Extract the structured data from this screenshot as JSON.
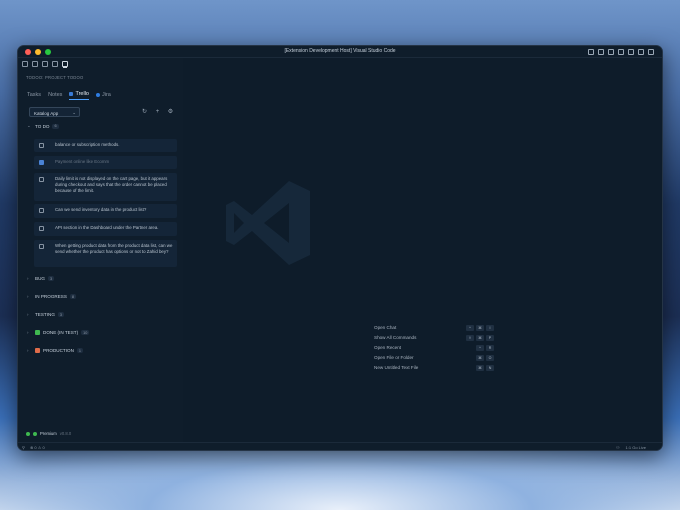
{
  "window": {
    "title": "[Extension Development Host] Visual Studio Code"
  },
  "sidebar": {
    "section_title": "TODOO: PROJECT TODOO",
    "tabs": [
      {
        "label": "Tasks",
        "active": false
      },
      {
        "label": "Notes",
        "active": false
      },
      {
        "label": "Trello",
        "active": true
      },
      {
        "label": "Jira",
        "active": false
      }
    ],
    "board_select": {
      "value": "Katalog App"
    },
    "lists": [
      {
        "name": "TO DO",
        "count": "6",
        "expanded": true,
        "cards": [
          {
            "text": "balance or subscription methods.",
            "checked": false
          },
          {
            "text": "Payment online like Ecomm",
            "checked": true
          },
          {
            "text": "Daily limit is not displayed on the cart page, but it appears during checkout and says that the order cannot be placed because of the limit.",
            "checked": false
          },
          {
            "text": "Can we send inventory data in the product list?",
            "checked": false
          },
          {
            "text": "API section in the Dashboard under the Partner area.",
            "checked": false
          },
          {
            "text": "When getting product data from the product data list, can we send whether the product has options or not to Zahid bey?",
            "checked": false
          }
        ]
      },
      {
        "name": "BUG",
        "count": "3",
        "expanded": false
      },
      {
        "name": "IN PROGRESS",
        "count": "8",
        "expanded": false
      },
      {
        "name": "TESTING",
        "count": "3",
        "expanded": false
      },
      {
        "name": "DONE (IN TEST)",
        "count": "10",
        "expanded": false,
        "emoji": "check-emoji"
      },
      {
        "name": "PRODUCTION",
        "count": "1",
        "expanded": false,
        "emoji": "rocket-emoji"
      }
    ],
    "premium": {
      "label": "Premium",
      "version": "v0.8.0"
    }
  },
  "editor": {
    "shortcuts": [
      {
        "label": "Open Chat",
        "keys": [
          "^",
          "⌘",
          "I"
        ]
      },
      {
        "label": "Show All Commands",
        "keys": [
          "⇧",
          "⌘",
          "P"
        ]
      },
      {
        "label": "Open Recent",
        "keys": [
          "^",
          "R"
        ]
      },
      {
        "label": "Open File or Folder",
        "keys": [
          "⌘",
          "O"
        ]
      },
      {
        "label": "New Untitled Text File",
        "keys": [
          "⌘",
          "N"
        ]
      }
    ]
  },
  "statusbar": {
    "errors": "0",
    "warnings": "0",
    "position": "1:1 Go Live"
  },
  "colors": {
    "accent": "#4ea1ff",
    "background": "#0f1d2b",
    "card": "#142538"
  }
}
